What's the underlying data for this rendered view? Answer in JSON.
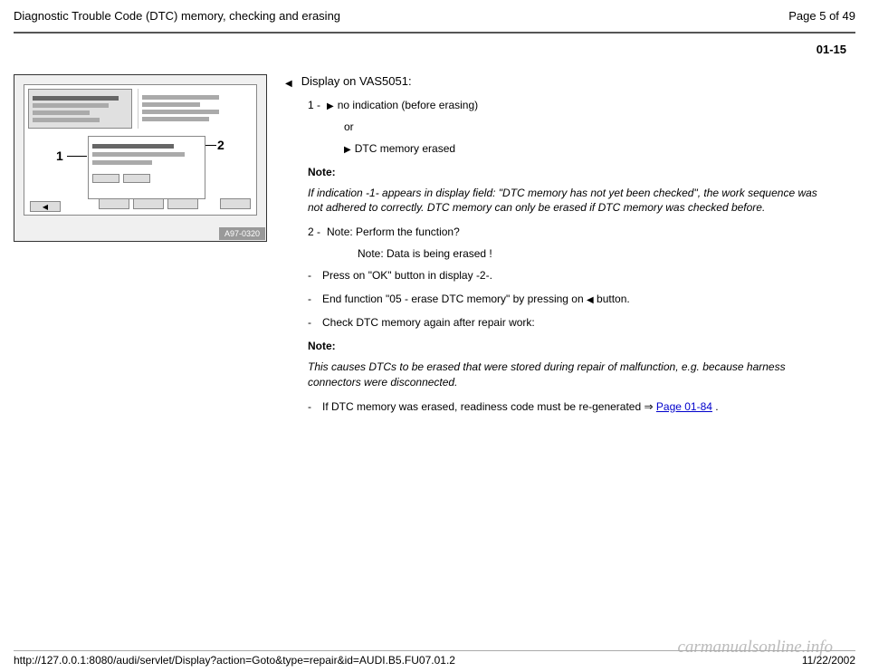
{
  "header": {
    "title": "Diagnostic Trouble Code (DTC) memory, checking and erasing",
    "page_info": "Page 5 of 49"
  },
  "section_number": "01-15",
  "figure": {
    "callout1": "1",
    "callout2": "2",
    "label": "A97-0320"
  },
  "content": {
    "display_heading": "Display on VAS5051:",
    "item1": {
      "num": "1 -",
      "text": "no indication (before erasing)",
      "or": "or",
      "alt": "DTC memory erased"
    },
    "note1": {
      "label": "Note:",
      "text": "If indication -1- appears in display field: \"DTC memory has not yet been checked\", the work sequence was not adhered to correctly. DTC memory can only be erased if DTC memory was checked before."
    },
    "item2": {
      "num": "2 -",
      "text": "Note: Perform the function?",
      "sub": "Note: Data is being erased !"
    },
    "steps": {
      "s1": "Press on \"OK\" button in display -2-.",
      "s2a": "End function \"05 - erase DTC memory\" by pressing on ",
      "s2b": " button.",
      "s3": "Check DTC memory again after repair work:"
    },
    "note2": {
      "label": "Note:",
      "text": "This causes DTCs to be erased that were stored during repair of malfunction, e.g. because harness connectors were disconnected."
    },
    "final": {
      "a": "If DTC memory was erased, readiness code must be re-generated  ⇒ ",
      "link": "Page 01-84",
      "b": " ."
    }
  },
  "footer": {
    "url": "http://127.0.0.1:8080/audi/servlet/Display?action=Goto&type=repair&id=AUDI.B5.FU07.01.2",
    "date": "11/22/2002"
  },
  "watermark": "carmanualsonline.info"
}
